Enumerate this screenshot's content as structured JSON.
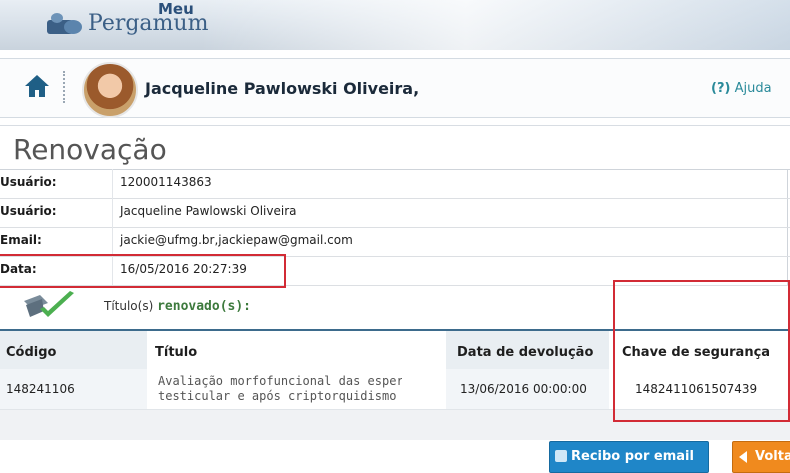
{
  "app": {
    "logo_top": "Meu",
    "logo_name": "Pergamum"
  },
  "userbar": {
    "home_icon": "home-icon",
    "user_name": "Jacqueline Pawlowski Oliveira,",
    "help_symbol": "(?)",
    "help_label": "Ajuda"
  },
  "page": {
    "title": "Renovação"
  },
  "info": {
    "rows": [
      {
        "label": "Usuário:",
        "value": "120001143863"
      },
      {
        "label": "Usuário:",
        "value": "Jacqueline Pawlowski Oliveira"
      },
      {
        "label": "Email:",
        "value": "jackie@ufmg.br,jackiepaw@gmail.com"
      },
      {
        "label": "Data:",
        "value": "16/05/2016 20:27:39"
      }
    ]
  },
  "status": {
    "prefix": "Título(s)",
    "strong": "renovado(s):"
  },
  "results": {
    "headers": [
      "Código",
      "Título",
      "Data de devolução",
      "Chave de segurança"
    ],
    "row": {
      "codigo": "148241106",
      "titulo_line1": "Avaliação morfofuncional das esperm:ura",
      "titulo_line2": "testicular e após criptorquidismo expe",
      "data_devolucao": "13/06/2016 00:00:00",
      "chave": "1482411061507439"
    }
  },
  "buttons": {
    "email": "Recibo por email",
    "back": "Volta"
  },
  "colors": {
    "highlight": "#d22b35",
    "email_button": "#1f86c8",
    "back_button": "#f08a1e",
    "header_line": "#3d6b8c"
  }
}
